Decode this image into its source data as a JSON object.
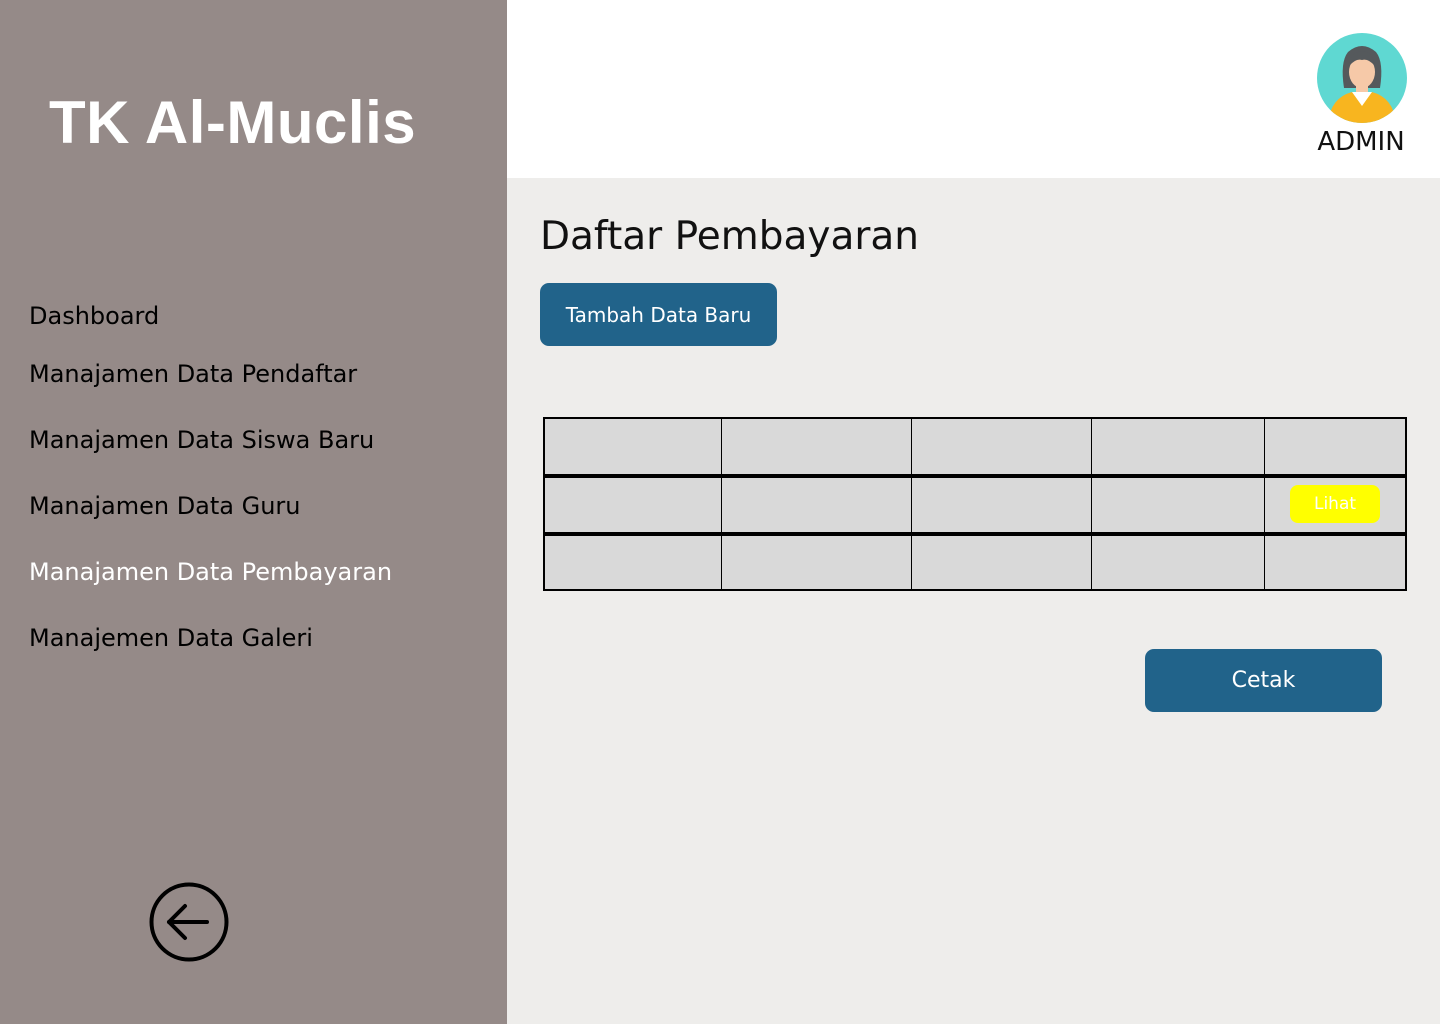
{
  "brand": {
    "title": "TK Al-Muclis"
  },
  "sidebar": {
    "items": [
      {
        "label": "Dashboard"
      },
      {
        "label": "Manajamen Data Pendaftar"
      },
      {
        "label": "Manajamen Data Siswa Baru"
      },
      {
        "label": "Manajamen Data Guru"
      },
      {
        "label": "Manajamen Data Pembayaran"
      },
      {
        "label": "Manajemen Data Galeri"
      }
    ],
    "active_index": 4,
    "back_icon": "arrow-left-circle-icon"
  },
  "header": {
    "user_label": "ADMIN",
    "avatar_icon": "female-user-avatar-icon"
  },
  "main": {
    "title": "Daftar Pembayaran",
    "add_button_label": "Tambah Data Baru",
    "view_button_label": "Lihat",
    "print_button_label": "Cetak"
  },
  "colors": {
    "sidebar_bg": "#958a88",
    "primary_button": "#21638a",
    "view_button": "#ffff00",
    "table_cell": "#d9d9d9",
    "content_bg": "#eeedeb"
  }
}
